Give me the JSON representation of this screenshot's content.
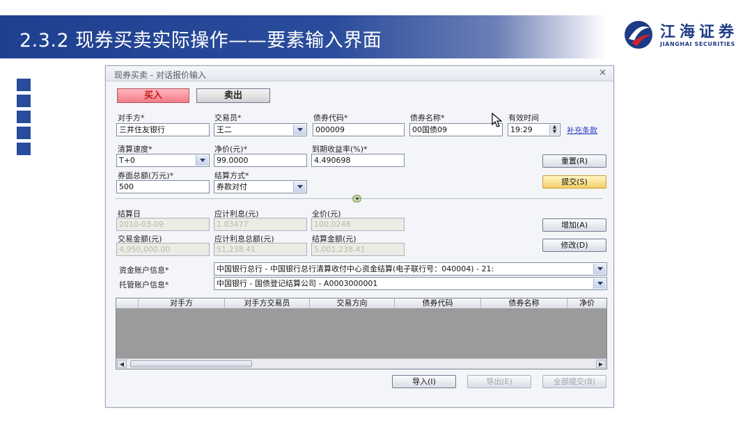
{
  "slide": {
    "title": "2.3.2 现券买卖实际操作——要素输入界面",
    "logo_cn": "江海证券",
    "logo_en": "JIANGHAI SECURITIES"
  },
  "dialog": {
    "title": "现券买卖 - 对话报价输入",
    "close_symbol": "×",
    "buy_label": "买入",
    "sell_label": "卖出"
  },
  "form": {
    "counterparty_label": "对手方*",
    "counterparty_value": "三井住友银行",
    "trader_label": "交易员*",
    "trader_value": "王二",
    "bond_code_label": "债券代码*",
    "bond_code_value": "000009",
    "bond_name_label": "债券名称*",
    "bond_name_value": "00国债09",
    "valid_time_label": "有效时间",
    "valid_time_value": "19:29",
    "supplement_link": "补充条款",
    "settle_speed_label": "清算速度*",
    "settle_speed_value": "T+0",
    "net_price_label": "净价(元)*",
    "net_price_value": "99.0000",
    "ytm_label": "到期收益率(%)*",
    "ytm_value": "4.490698",
    "face_amount_label": "券面总额(万元)*",
    "face_amount_value": "500",
    "settle_method_label": "结算方式*",
    "settle_method_value": "券款对付",
    "settle_date_label": "结算日",
    "settle_date_value": "2010-03-09",
    "accrued_label": "应计利息(元)",
    "accrued_value": "1.03477",
    "full_price_label": "全价(元)",
    "full_price_value": "100.0248",
    "trade_amount_label": "交易金额(元)",
    "trade_amount_value": "4,950,000.00",
    "accrued_total_label": "应计利息总额(元)",
    "accrued_total_value": "51,238.41",
    "settle_amount_label": "结算金额(元)",
    "settle_amount_value": "5,001,238.41",
    "fund_account_label": "资金账户信息*",
    "fund_account_value": "中国银行总行 - 中国银行总行清算收付中心资金结算(电子联行号：040004) - 21:",
    "custody_account_label": "托管账户信息*",
    "custody_account_value": "中国银行 - 国债登记结算公司 - A0003000001"
  },
  "buttons": {
    "reset": "重置(R)",
    "submit": "提交(S)",
    "add": "增加(A)",
    "modify": "修改(D)",
    "import": "导入(I)",
    "export": "导出(E)",
    "submit_all": "全部提交(B)"
  },
  "grid": {
    "columns": [
      "对手方",
      "对手方交易员",
      "交易方向",
      "债券代码",
      "债券名称",
      "净价"
    ]
  }
}
